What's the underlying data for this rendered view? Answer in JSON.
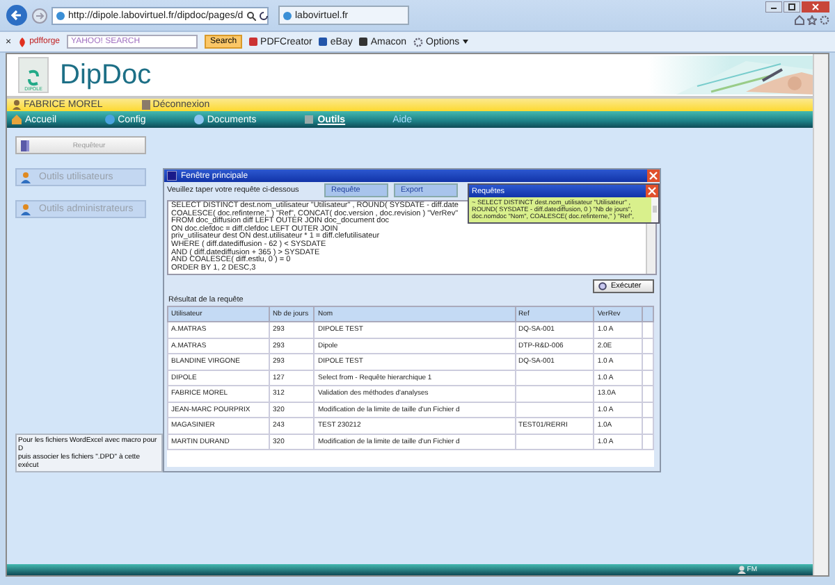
{
  "browser": {
    "address": "http://dipole.labovirtuel.fr/dipdoc/pages/d",
    "tab": "labovirtuel.fr",
    "toolbar": {
      "close": "×",
      "pdfforge": "pdfforge",
      "search_placeholder": "YAHOO! SEARCH",
      "search_button": "Search",
      "links": [
        "PDFCreator",
        "eBay",
        "Amacon"
      ],
      "options": "Options"
    }
  },
  "header": {
    "logo_text": "DIPOLE",
    "title": "DipDoc"
  },
  "user_bar": {
    "user": "FABRICE MOREL",
    "logout": "Déconnexion"
  },
  "nav": [
    {
      "label": "Accueil",
      "selected": false,
      "disabled": false
    },
    {
      "label": "Config",
      "selected": false,
      "disabled": false
    },
    {
      "label": "Documents",
      "selected": false,
      "disabled": false
    },
    {
      "label": "Outils",
      "selected": true,
      "disabled": false
    },
    {
      "label": "Aide",
      "selected": false,
      "disabled": true
    }
  ],
  "sidebar": {
    "items": [
      {
        "label": "Requêteur",
        "kind": "primary"
      },
      {
        "label": "Outils utilisateurs",
        "kind": "link"
      },
      {
        "label": "Outils administrateurs",
        "kind": "link"
      }
    ],
    "note": [
      "Pour les fichiers WordExcel avec macro pour D",
      "puis associer les fichiers \".DPD\" à cette exécut"
    ]
  },
  "dialog": {
    "title": "Fenêtre principale",
    "prompt": "Veuillez taper votre requête ci-dessous",
    "tabs": [
      {
        "label": "Requête",
        "selected": false
      },
      {
        "label": "Export",
        "selected": false
      }
    ],
    "query_lines": [
      "SELECT DISTINCT dest.nom_utilisateur \"Utilisateur\" , ROUND( SYSDATE - diff.date",
      "COALESCE( doc.refinterne,'' ) \"Ref\", CONCAT( doc.version , doc.revision ) \"VerRev\"",
      "FROM doc_diffusion diff LEFT OUTER JOIN doc_document doc",
      "ON doc.clefdoc = diff.clefdoc LEFT OUTER JOIN",
      "priv_utilisateur dest ON dest.utilisateur * 1 = diff.clefutilisateur",
      "WHERE ( diff.datediffusion - 62 ) < SYSDATE",
      "AND ( diff.datediffusion + 365 ) > SYSDATE",
      "AND COALESCE( diff.estlu, 0 ) = 0",
      "ORDER BY  1, 2 DESC,3"
    ],
    "popup": {
      "title": "Requêtes",
      "text": "~ SELECT DISTINCT dest.nom_utilisateur \"Utilisateur\" , ROUND( SYSDATE - diff.datediffusion, 0 ) \"Nb de jours\", doc.nomdoc \"Nom\", COALESCE( doc.refinterne,'' ) \"Ref\","
    },
    "run_button": "Exécuter",
    "result_label": "Résultat de la requête",
    "table": {
      "columns": [
        "Utilisateur",
        "Nb de jours",
        "Nom",
        "Ref",
        "VerRev"
      ],
      "rows": [
        [
          "A.MATRAS",
          "293",
          "DIPOLE TEST",
          "DQ-SA-001",
          "1.0 A"
        ],
        [
          "A.MATRAS",
          "293",
          "Dipole",
          "DTP-R&D-006",
          "2.0E"
        ],
        [
          "BLANDINE VIRGONE",
          "293",
          "DIPOLE TEST",
          "DQ-SA-001",
          "1.0 A"
        ],
        [
          "DIPOLE",
          "127",
          "Select from - Requête hierarchique 1",
          "",
          "1.0 A"
        ],
        [
          "FABRICE MOREL",
          "312",
          "Validation des méthodes d'analyses",
          "",
          "13.0A"
        ],
        [
          "JEAN-MARC POURPRIX",
          "320",
          "Modification de la limite de taille d'un Fichier d",
          "",
          "1.0 A"
        ],
        [
          "MAGASINIER",
          "243",
          "TEST 230212",
          "TEST01/RERRI",
          "1.0A"
        ],
        [
          "MARTIN DURAND",
          "320",
          "Modification de la limite de taille d'un Fichier d",
          "",
          "1.0 A"
        ]
      ]
    }
  },
  "footer": {
    "badge": "FM"
  }
}
